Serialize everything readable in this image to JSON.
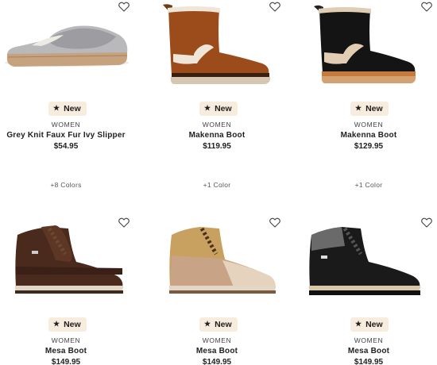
{
  "products": [
    {
      "badge": "New",
      "category": "WOMEN",
      "name": "Grey Knit Faux Fur Ivy Slipper",
      "price": "$54.95",
      "colors": "+8 Colors"
    },
    {
      "badge": "New",
      "category": "WOMEN",
      "name": "Makenna Boot",
      "price": "$119.95",
      "colors": "+1 Color"
    },
    {
      "badge": "New",
      "category": "WOMEN",
      "name": "Makenna Boot",
      "price": "$129.95",
      "colors": "+1 Color"
    },
    {
      "badge": "New",
      "category": "WOMEN",
      "name": "Mesa Boot",
      "price": "$149.95"
    },
    {
      "badge": "New",
      "category": "WOMEN",
      "name": "Mesa Boot",
      "price": "$149.95"
    },
    {
      "badge": "New",
      "category": "WOMEN",
      "name": "Mesa Boot",
      "price": "$149.95"
    }
  ],
  "icons": {
    "wishlist": "heart-outline-icon",
    "badge": "star-icon"
  },
  "colors": {
    "badge_bg": "#f7ecdd",
    "text": "#1f1f1f"
  }
}
